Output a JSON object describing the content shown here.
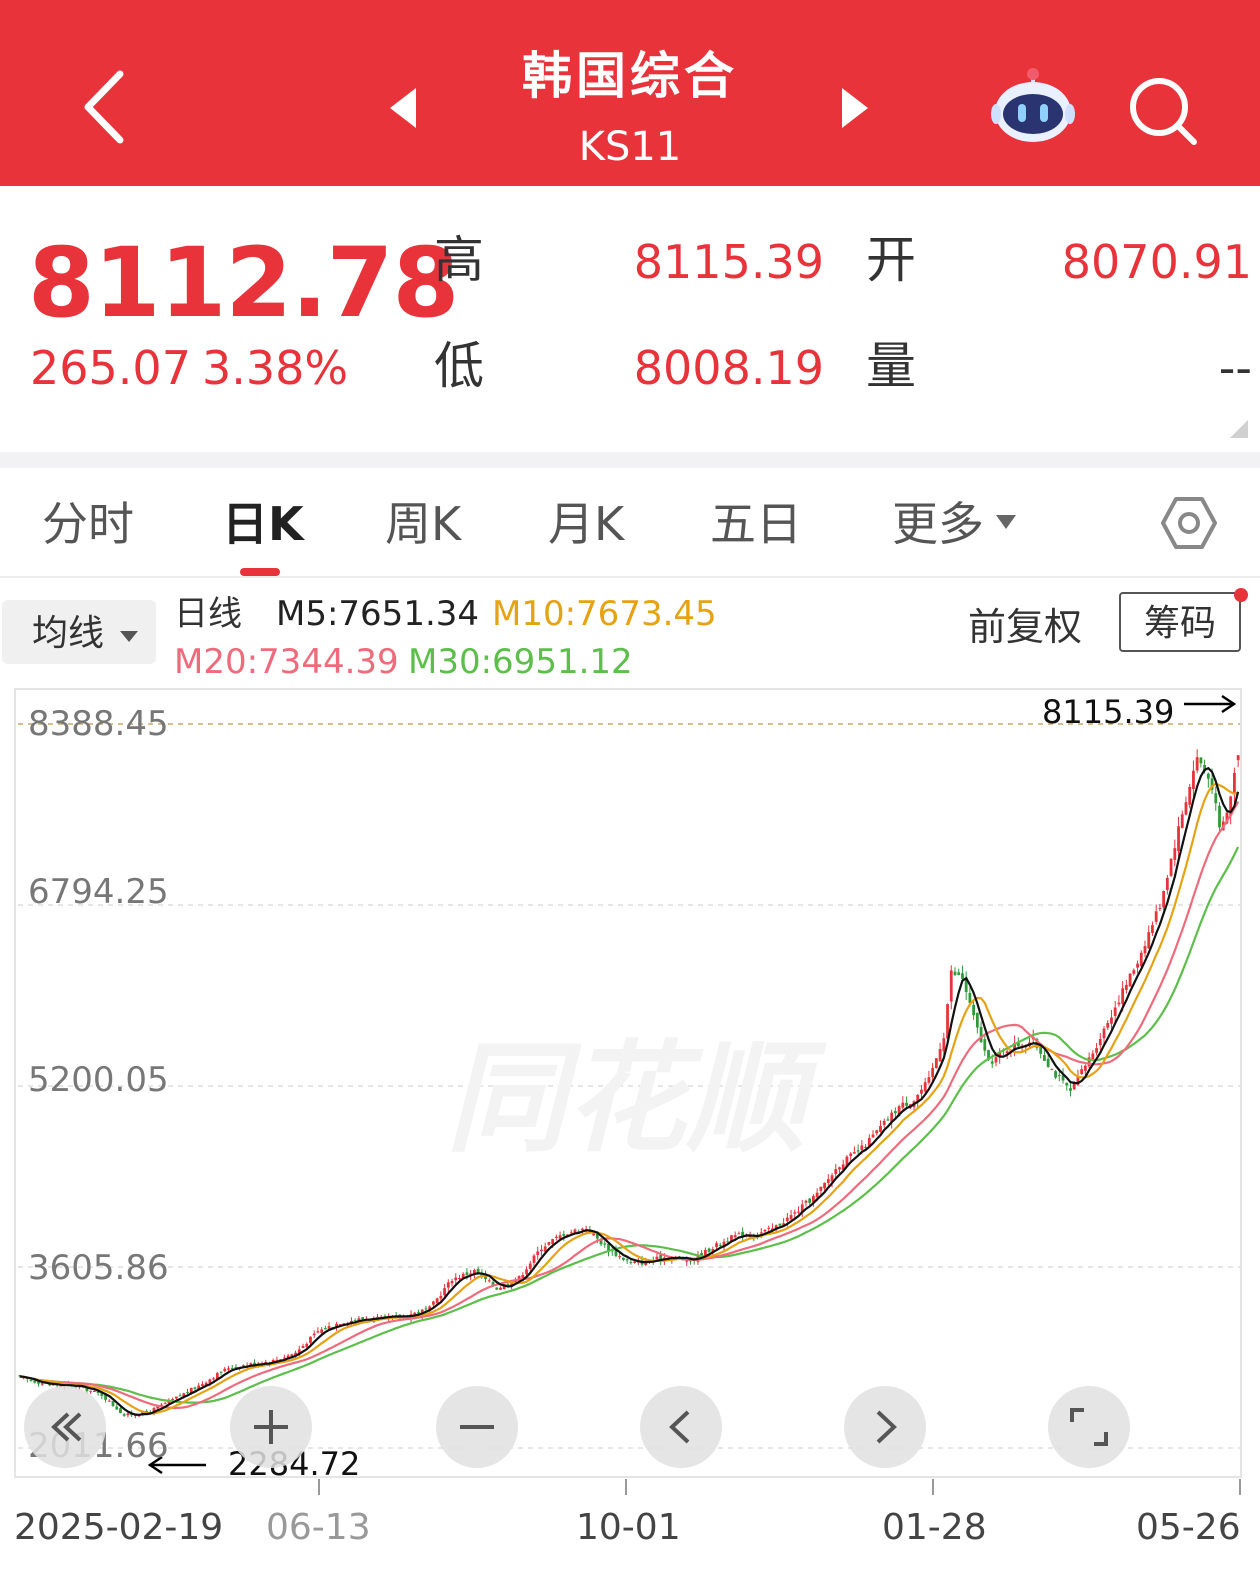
{
  "header": {
    "title": "韩国综合",
    "code": "KS11"
  },
  "quote": {
    "price": "8112.78",
    "change": "265.07",
    "change_pct": "3.38%",
    "high_label": "高",
    "high": "8115.39",
    "open_label": "开",
    "open": "8070.91",
    "low_label": "低",
    "low": "8008.19",
    "volume_label": "量",
    "volume": "--"
  },
  "tabs": [
    {
      "label": "分时"
    },
    {
      "label": "日K",
      "active": true
    },
    {
      "label": "周K"
    },
    {
      "label": "月K"
    },
    {
      "label": "五日"
    },
    {
      "label": "更多"
    }
  ],
  "chart_header": {
    "ma_dropdown": "均线",
    "line_label": "日线",
    "m5": "M5:7651.34",
    "m10": "M10:7673.45",
    "m20": "M20:7344.39",
    "m30": "M30:6951.12",
    "adjust": "前复权",
    "chips": "筹码"
  },
  "chart_data": {
    "type": "candlestick",
    "y_ticks": [
      "8388.45",
      "6794.25",
      "5200.05",
      "3605.86",
      "2011.66"
    ],
    "x_ticks": [
      "2025-02-19",
      "06-13",
      "10-01",
      "01-28",
      "05-26"
    ],
    "max_marker": "8115.39",
    "min_marker": "2284.72",
    "ylim": [
      2011.66,
      8388.45
    ],
    "watermark": "同花顺",
    "close_path": [
      [
        0,
        2630
      ],
      [
        8,
        2570
      ],
      [
        16,
        2550
      ],
      [
        22,
        2480
      ],
      [
        28,
        2300
      ],
      [
        34,
        2320
      ],
      [
        40,
        2420
      ],
      [
        48,
        2560
      ],
      [
        56,
        2720
      ],
      [
        62,
        2750
      ],
      [
        68,
        2780
      ],
      [
        74,
        2850
      ],
      [
        80,
        3040
      ],
      [
        86,
        3120
      ],
      [
        92,
        3150
      ],
      [
        98,
        3150
      ],
      [
        104,
        3180
      ],
      [
        110,
        3240
      ],
      [
        116,
        3500
      ],
      [
        122,
        3570
      ],
      [
        128,
        3420
      ],
      [
        134,
        3510
      ],
      [
        140,
        3780
      ],
      [
        146,
        3900
      ],
      [
        152,
        3950
      ],
      [
        158,
        3760
      ],
      [
        164,
        3640
      ],
      [
        168,
        3650
      ],
      [
        174,
        3700
      ],
      [
        180,
        3660
      ],
      [
        186,
        3780
      ],
      [
        192,
        3880
      ],
      [
        198,
        3900
      ],
      [
        202,
        3940
      ],
      [
        208,
        4080
      ],
      [
        214,
        4250
      ],
      [
        220,
        4510
      ],
      [
        226,
        4650
      ],
      [
        232,
        4870
      ],
      [
        236,
        5020
      ],
      [
        240,
        5080
      ],
      [
        244,
        5250
      ],
      [
        248,
        5650
      ],
      [
        250,
        6200
      ],
      [
        253,
        6150
      ],
      [
        256,
        5800
      ],
      [
        260,
        5400
      ],
      [
        266,
        5550
      ],
      [
        272,
        5600
      ],
      [
        278,
        5300
      ],
      [
        282,
        5150
      ],
      [
        288,
        5500
      ],
      [
        294,
        5900
      ],
      [
        300,
        6300
      ],
      [
        306,
        6800
      ],
      [
        312,
        7600
      ],
      [
        316,
        8100
      ],
      [
        320,
        7850
      ],
      [
        322,
        7450
      ],
      [
        324,
        7600
      ],
      [
        327,
        8112.78
      ]
    ]
  }
}
